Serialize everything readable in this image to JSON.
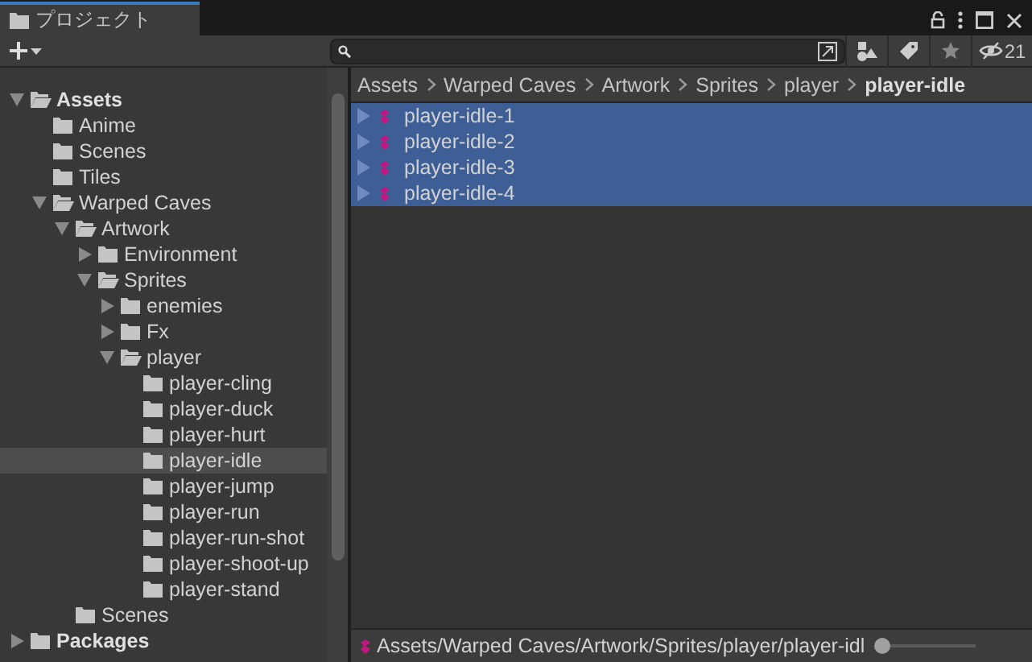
{
  "window": {
    "tab_title": "プロジェクト"
  },
  "toolbar": {
    "hidden_count": "21"
  },
  "tree": [
    {
      "label": "Assets",
      "expanded": true,
      "selected": false,
      "children": [
        {
          "label": "Anime",
          "selected": false
        },
        {
          "label": "Scenes",
          "selected": false
        },
        {
          "label": "Tiles",
          "selected": false
        },
        {
          "label": "Warped Caves",
          "expanded": true,
          "selected": false,
          "children": [
            {
              "label": "Artwork",
              "expanded": true,
              "selected": false,
              "children": [
                {
                  "label": "Environment",
                  "expanded": false,
                  "selected": false
                },
                {
                  "label": "Sprites",
                  "expanded": true,
                  "selected": false,
                  "children": [
                    {
                      "label": "enemies",
                      "expanded": false,
                      "selected": false
                    },
                    {
                      "label": "Fx",
                      "expanded": false,
                      "selected": false
                    },
                    {
                      "label": "player",
                      "expanded": true,
                      "selected": false,
                      "children": [
                        {
                          "label": "player-cling",
                          "selected": false
                        },
                        {
                          "label": "player-duck",
                          "selected": false
                        },
                        {
                          "label": "player-hurt",
                          "selected": false
                        },
                        {
                          "label": "player-idle",
                          "selected": true
                        },
                        {
                          "label": "player-jump",
                          "selected": false
                        },
                        {
                          "label": "player-run",
                          "selected": false
                        },
                        {
                          "label": "player-run-shot",
                          "selected": false
                        },
                        {
                          "label": "player-shoot-up",
                          "selected": false
                        },
                        {
                          "label": "player-stand",
                          "selected": false
                        }
                      ]
                    }
                  ]
                }
              ]
            },
            {
              "label": "Scenes",
              "selected": false
            }
          ]
        }
      ]
    },
    {
      "label": "Packages",
      "expanded": false,
      "selected": false
    }
  ],
  "breadcrumb": [
    "Assets",
    "Warped Caves",
    "Artwork",
    "Sprites",
    "player",
    "player-idle"
  ],
  "files": [
    {
      "label": "player-idle-1",
      "selected": true
    },
    {
      "label": "player-idle-2",
      "selected": true
    },
    {
      "label": "player-idle-3",
      "selected": true
    },
    {
      "label": "player-idle-4",
      "selected": true
    }
  ],
  "status_bar": {
    "path": "Assets/Warped Caves/Artwork/Sprites/player/player-idl",
    "zoom": {
      "level": 0
    }
  }
}
